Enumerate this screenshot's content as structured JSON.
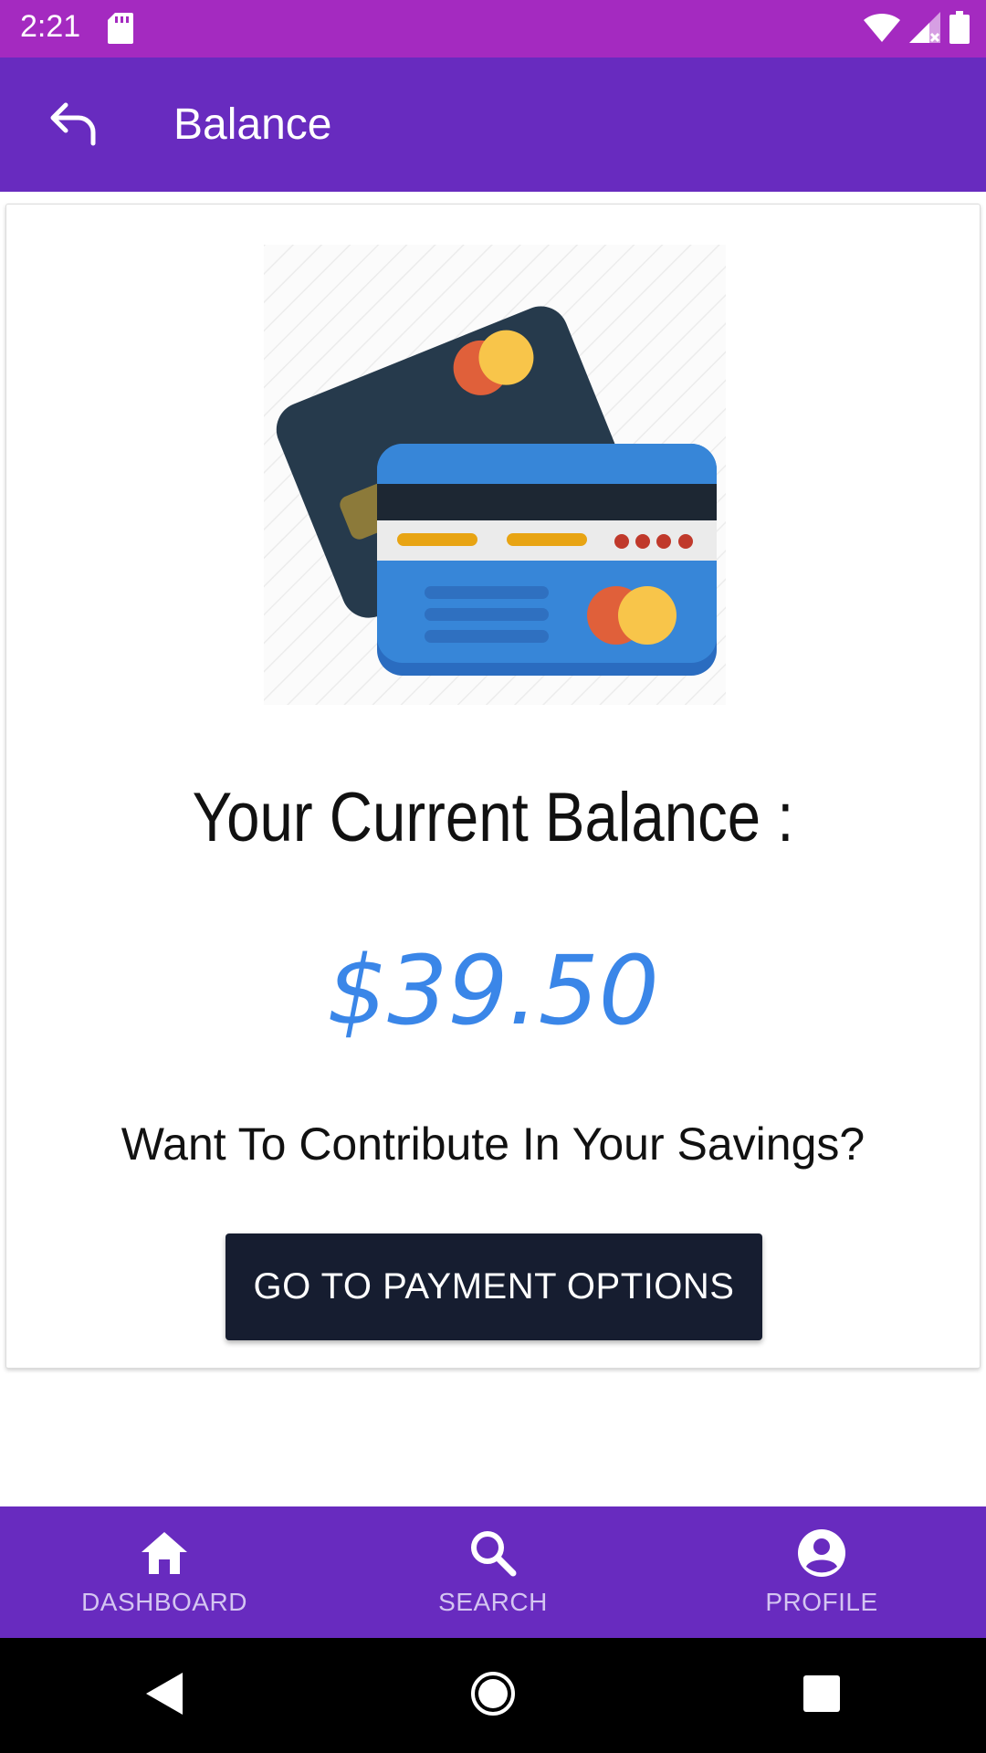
{
  "status_bar": {
    "time": "2:21",
    "icons": [
      "sd-card-icon",
      "wifi-icon",
      "signal-icon",
      "battery-icon"
    ]
  },
  "app_bar": {
    "title": "Balance",
    "back_icon": "back-arrow-icon"
  },
  "balance_card": {
    "illustration": "credit-cards-illustration",
    "label": "Your Current Balance :",
    "amount": "$39.50",
    "contribute_prompt": "Want To Contribute In Your Savings?",
    "button_label": "GO TO PAYMENT OPTIONS"
  },
  "bottom_nav": {
    "items": [
      {
        "label": "DASHBOARD",
        "icon": "home-icon"
      },
      {
        "label": "SEARCH",
        "icon": "search-icon"
      },
      {
        "label": "PROFILE",
        "icon": "account-circle-icon"
      }
    ]
  },
  "system_nav": {
    "icons": [
      "back-triangle-icon",
      "home-circle-icon",
      "recents-square-icon"
    ]
  },
  "colors": {
    "status_bar": "#a42ac0",
    "app_bar": "#682bbf",
    "amount": "#3a86e8",
    "button": "#161d30",
    "nav_label": "#d4c5f1"
  }
}
